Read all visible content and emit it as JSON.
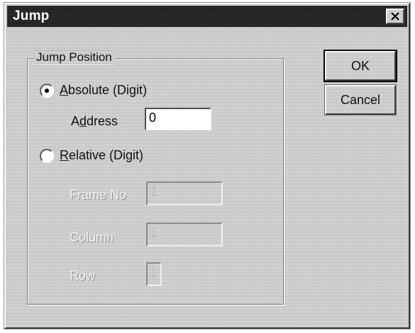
{
  "window": {
    "title": "Jump"
  },
  "icons": {
    "close": "close-icon"
  },
  "group": {
    "label": "Jump Position"
  },
  "options": {
    "absolute": {
      "mnemonic": "A",
      "rest": "bsolute (Digit)",
      "selected": true
    },
    "relative": {
      "mnemonic": "R",
      "rest": "elative (Digit)",
      "selected": false
    }
  },
  "fields": {
    "address": {
      "label_pre": "A",
      "label_mnemonic": "d",
      "label_post": "dress",
      "value": "0"
    },
    "frame_no": {
      "label": "Frame No",
      "value": "1"
    },
    "column": {
      "label": "Column",
      "value": "1"
    },
    "row": {
      "label": "Row",
      "value": "1"
    }
  },
  "buttons": {
    "ok": "OK",
    "cancel": "Cancel"
  },
  "colors": {
    "titlebar": "#2a2a2a",
    "face": "#c8c8c8",
    "disabled_text": "#bdbdbd"
  }
}
